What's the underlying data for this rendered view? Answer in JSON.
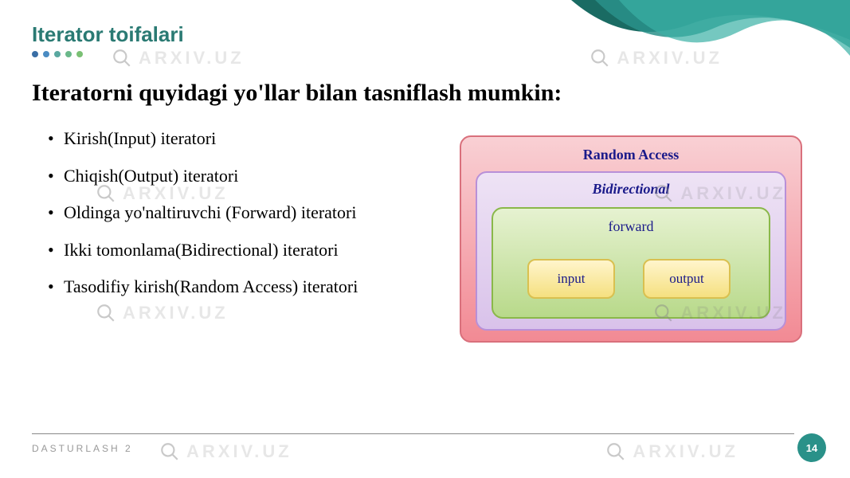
{
  "slide": {
    "title": "Iterator toifalari",
    "subtitle": "Iteratorni quyidagi yo'llar bilan tasniflash mumkin:",
    "bullets": [
      "Kirish(Input) iteratori",
      "Chiqish(Output) iteratori",
      "Oldinga yo'naltiruvchi (Forward) iteratori",
      "Ikki tomonlama(Bidirectional) iteratori",
      "Tasodifiy kirish(Random Access) iteratori"
    ],
    "footer": "DASTURLASH 2",
    "page_number": "14"
  },
  "diagram": {
    "random_access": "Random Access",
    "bidirectional": "Bidirectional",
    "forward": "forward",
    "input": "input",
    "output": "output"
  },
  "dot_colors": [
    "#3a6ea5",
    "#4a8bc2",
    "#5aa8a0",
    "#6ab88a",
    "#7ac074"
  ],
  "watermark_text": "ARXIV.UZ"
}
